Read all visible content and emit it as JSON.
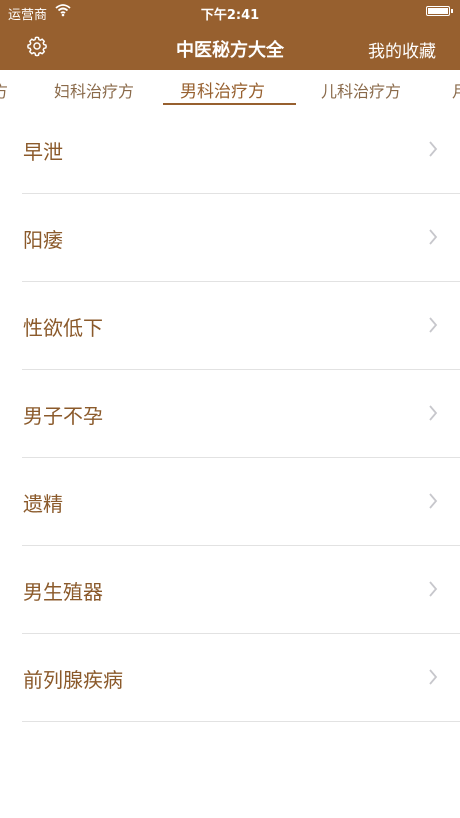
{
  "status_bar": {
    "carrier": "运营商",
    "time": "下午2:41",
    "battery_level": 1.0
  },
  "navbar": {
    "title": "中医秘方大全",
    "favorites_label": "我的收藏",
    "settings_icon": "gear-icon"
  },
  "tabs": [
    {
      "label": "方",
      "active": false
    },
    {
      "label": "妇科治疗方",
      "active": false
    },
    {
      "label": "男科治疗方",
      "active": true
    },
    {
      "label": "儿科治疗方",
      "active": false
    },
    {
      "label": "月",
      "active": false
    }
  ],
  "list": {
    "items": [
      {
        "label": "早泄"
      },
      {
        "label": "阳痿"
      },
      {
        "label": "性欲低下"
      },
      {
        "label": "男子不孕"
      },
      {
        "label": "遗精"
      },
      {
        "label": "男生殖器"
      },
      {
        "label": "前列腺疾病"
      }
    ],
    "chevron_icon": "chevron-right-icon"
  },
  "colors": {
    "header_bg": "#97602f",
    "accent": "#97602f",
    "item_text": "#8b5a2b",
    "divider": "#e2e2e2"
  }
}
